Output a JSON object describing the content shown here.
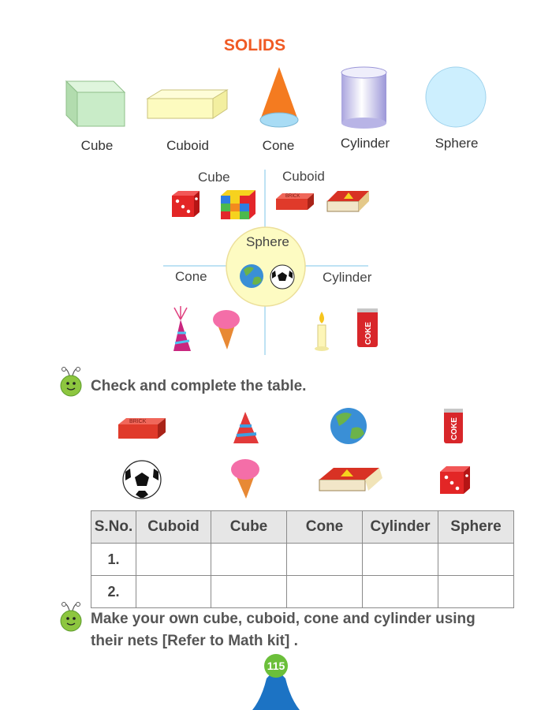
{
  "title": "SOLIDS",
  "solids": {
    "cube": "Cube",
    "cuboid": "Cuboid",
    "cone": "Cone",
    "cylinder": "Cylinder",
    "sphere": "Sphere"
  },
  "diagram": {
    "cube": "Cube",
    "cuboid": "Cuboid",
    "sphere": "Sphere",
    "cone": "Cone",
    "cylinder": "Cylinder",
    "brick_text": "BRICK",
    "coke_text": "COKE"
  },
  "instructions": {
    "check": "Check and complete the table.",
    "make_line1": "Make your own cube, cuboid, cone and cylinder using",
    "make_line2": "their nets [Refer to Math kit] ."
  },
  "table": {
    "headers": [
      "S.No.",
      "Cuboid",
      "Cube",
      "Cone",
      "Cylinder",
      "Sphere"
    ],
    "rows": [
      "1.",
      "2."
    ]
  },
  "page_number": "115",
  "colors": {
    "title": "#f05a24",
    "cube_fill": "#c9ecc8",
    "cuboid_fill": "#fdfbbf",
    "cone_fill": "#f47b20",
    "cylinder_fill": "#c5c2ea",
    "sphere_fill": "#cdeffe",
    "page_tab": "#1c73c4",
    "page_badge": "#6bbf3a"
  }
}
